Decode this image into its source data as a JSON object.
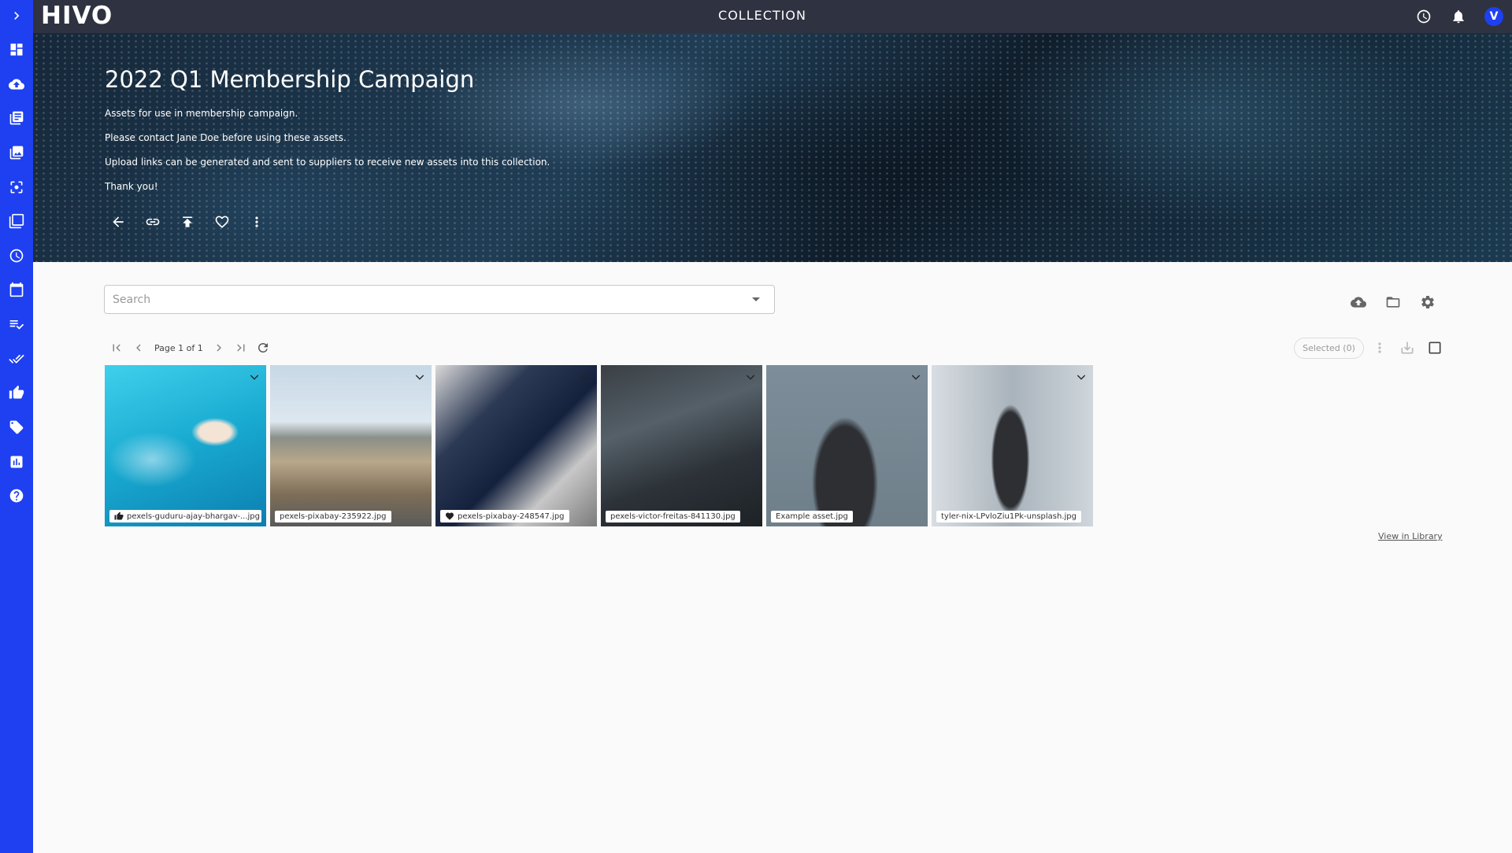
{
  "app": {
    "logo": "HIVO",
    "title": "COLLECTION",
    "avatar_initial": "V",
    "accent_color": "#1e40f0"
  },
  "sidebar": {
    "items": [
      {
        "icon": "chevron-right-icon"
      },
      {
        "icon": "dashboard-icon"
      },
      {
        "icon": "cloud-upload-icon"
      },
      {
        "icon": "library-icon"
      },
      {
        "icon": "photo-library-icon"
      },
      {
        "icon": "center-focus-icon"
      },
      {
        "icon": "copy-icon"
      },
      {
        "icon": "clock-icon"
      },
      {
        "icon": "calendar-icon"
      },
      {
        "icon": "playlist-check-icon"
      },
      {
        "icon": "done-all-icon"
      },
      {
        "icon": "thumb-up-icon"
      },
      {
        "icon": "tag-icon"
      },
      {
        "icon": "chart-icon"
      },
      {
        "icon": "help-icon"
      }
    ]
  },
  "banner": {
    "title": "2022 Q1 Membership Campaign",
    "lines": [
      "Assets for use in membership campaign.",
      "Please contact Jane Doe before using these assets.",
      "Upload links can be generated and sent to suppliers to receive new assets into this collection.",
      "Thank you!"
    ]
  },
  "search": {
    "placeholder": "Search",
    "value": ""
  },
  "pager": {
    "text": "Page 1 of 1"
  },
  "selection": {
    "label": "Selected (0)"
  },
  "assets": [
    {
      "filename": "pexels-guduru-ajay-bhargav-...jpg",
      "badge": "thumb-up-icon"
    },
    {
      "filename": "pexels-pixabay-235922.jpg",
      "badge": ""
    },
    {
      "filename": "pexels-pixabay-248547.jpg",
      "badge": "heart-icon"
    },
    {
      "filename": "pexels-victor-freitas-841130.jpg",
      "badge": ""
    },
    {
      "filename": "Example asset.jpg",
      "badge": ""
    },
    {
      "filename": "tyler-nix-LPvloZiu1Pk-unsplash.jpg",
      "badge": ""
    }
  ],
  "footer": {
    "view_library": "View in Library"
  }
}
